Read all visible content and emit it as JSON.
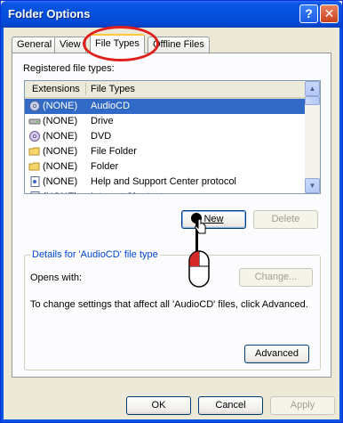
{
  "window": {
    "title": "Folder Options"
  },
  "tabs": [
    "General",
    "View",
    "File Types",
    "Offline Files"
  ],
  "registered_label": "Registered file types:",
  "list": {
    "columns": [
      "Extensions",
      "File Types"
    ],
    "rows": [
      {
        "ext": "(NONE)",
        "type": "AudioCD",
        "icon": "cd-icon"
      },
      {
        "ext": "(NONE)",
        "type": "Drive",
        "icon": "drive-icon"
      },
      {
        "ext": "(NONE)",
        "type": "DVD",
        "icon": "dvd-icon"
      },
      {
        "ext": "(NONE)",
        "type": "File Folder",
        "icon": "folder-icon"
      },
      {
        "ext": "(NONE)",
        "type": "Folder",
        "icon": "folder-icon"
      },
      {
        "ext": "(NONE)",
        "type": "Help and Support Center protocol",
        "icon": "document-icon"
      },
      {
        "ext": "(NONE)",
        "type": "Internet Shortcut",
        "icon": "shortcut-icon"
      }
    ],
    "selected_index": 0
  },
  "buttons": {
    "new": "New",
    "delete": "Delete",
    "change": "Change...",
    "advanced": "Advanced",
    "ok": "OK",
    "cancel": "Cancel",
    "apply": "Apply"
  },
  "details": {
    "title": "Details for 'AudioCD' file type",
    "opens_with": "Opens with:",
    "info": "To change settings that affect all 'AudioCD' files, click Advanced."
  },
  "colors": {
    "accent": "#0A53E3",
    "highlight": "#3169C6",
    "annotation": "#E0201C"
  }
}
